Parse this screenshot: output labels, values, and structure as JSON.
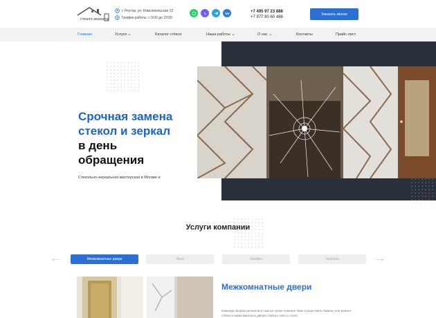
{
  "header": {
    "logo_text": "стекло-зеркала",
    "address": "г. Реутов, ул. Комсомольская 12",
    "hours": "График работы: с 9:00 до 23:00",
    "phone1": "+7 495 97 23 888",
    "phone2": "+7 977 80 60 486",
    "call_button": "Заказать звонок",
    "accent_color": "#2b6fd2",
    "socials": [
      "whatsapp-icon",
      "viber-icon",
      "telegram-icon",
      "vk-icon"
    ]
  },
  "nav": {
    "items": [
      {
        "label": "Главная",
        "active": true
      },
      {
        "label": "Услуги",
        "dropdown": true
      },
      {
        "label": "Каталог стёкол"
      },
      {
        "label": "Наши работы",
        "dropdown": true
      },
      {
        "label": "О нас",
        "dropdown": true
      },
      {
        "label": "Контакты"
      },
      {
        "label": "Прайс-лист"
      }
    ]
  },
  "hero": {
    "title_line1": "Срочная замена",
    "title_line2": "стекол и зеркал",
    "title_line3": "в день",
    "title_line4": "обращения",
    "subtitle": "Стекольно-зеркальная мастерская в Москве и"
  },
  "services": {
    "title": "Услуги компании",
    "tabs": [
      "Межкомнатные двери",
      "Окна",
      "Шкафы",
      "Зеркала"
    ],
    "active_tab": "Межкомнатные двери",
    "heading": "Межкомнатные двери",
    "text": "Команда профессионалов в сжатые сроки поможет Вам осуществить Замену или ремонт стёкол в межкомнатных дверях любого типа и стиля"
  }
}
